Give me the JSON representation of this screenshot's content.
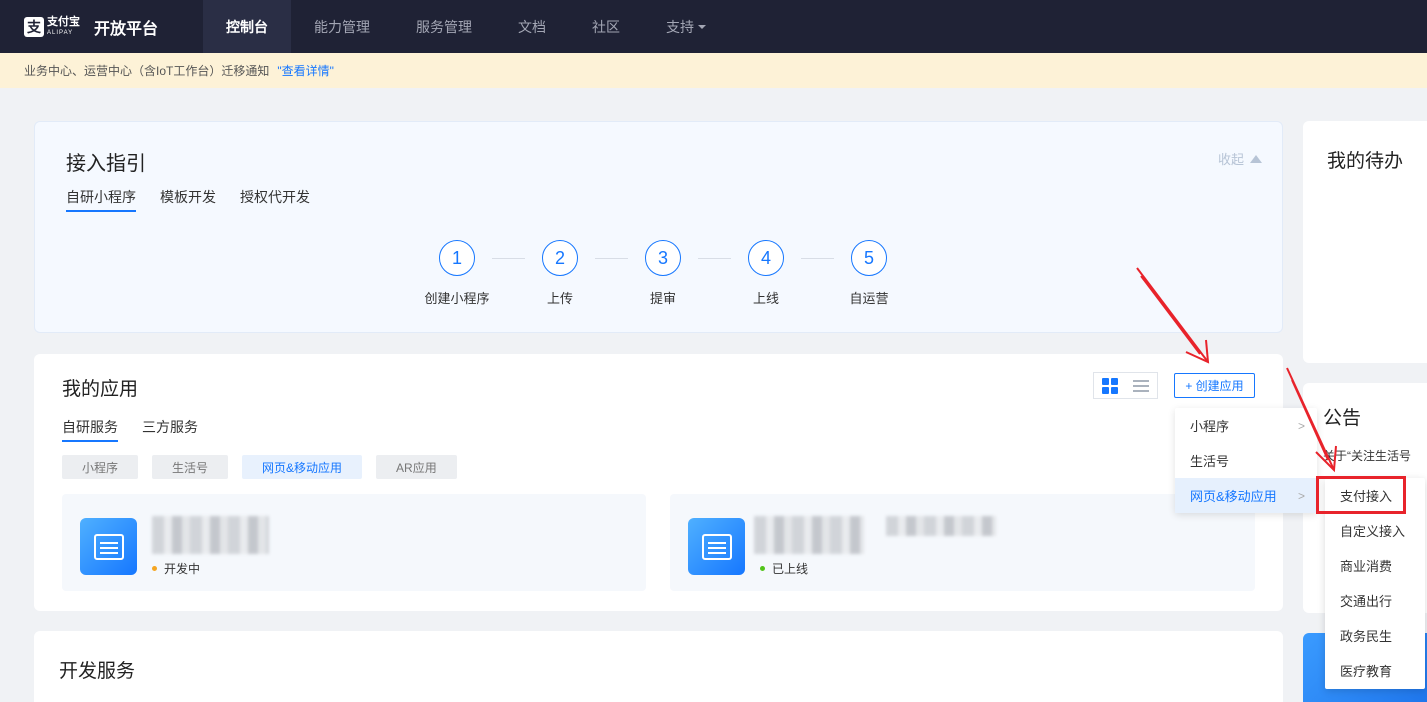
{
  "nav": {
    "logo_cn": "支付宝",
    "logo_en": "ALIPAY",
    "title": "开放平台",
    "items": [
      "控制台",
      "能力管理",
      "服务管理",
      "文档",
      "社区",
      "支持"
    ]
  },
  "notice": {
    "text": "业务中心、运营中心（含IoT工作台）迁移通知",
    "link": "\"查看详情\""
  },
  "guide": {
    "title": "接入指引",
    "collapse": "收起",
    "tabs": [
      "自研小程序",
      "模板开发",
      "授权代开发"
    ],
    "steps": [
      {
        "num": "1",
        "label": "创建小程序"
      },
      {
        "num": "2",
        "label": "上传"
      },
      {
        "num": "3",
        "label": "提审"
      },
      {
        "num": "4",
        "label": "上线"
      },
      {
        "num": "5",
        "label": "自运营"
      }
    ]
  },
  "apps": {
    "title": "我的应用",
    "create_label": "+ 创建应用",
    "tabs": [
      "自研服务",
      "三方服务"
    ],
    "chips": [
      "小程序",
      "生活号",
      "网页&移动应用",
      "AR应用"
    ],
    "items": [
      {
        "status": "开发中",
        "status_color": "#f5a623"
      },
      {
        "status": "已上线",
        "status_color": "#52c41a"
      }
    ]
  },
  "dev": {
    "title": "开发服务"
  },
  "todo": {
    "title": "我的待办"
  },
  "announce": {
    "title": "公告",
    "line1": "关于“关注生活号"
  },
  "menu1": [
    "小程序",
    "生活号",
    "网页&移动应用"
  ],
  "menu2": [
    "支付接入",
    "自定义接入",
    "商业消费",
    "交通出行",
    "政务民生",
    "医疗教育"
  ],
  "colors": {
    "accent": "#1677ff",
    "nav_bg": "#1f2235",
    "highlight_box": "#e8232b"
  }
}
